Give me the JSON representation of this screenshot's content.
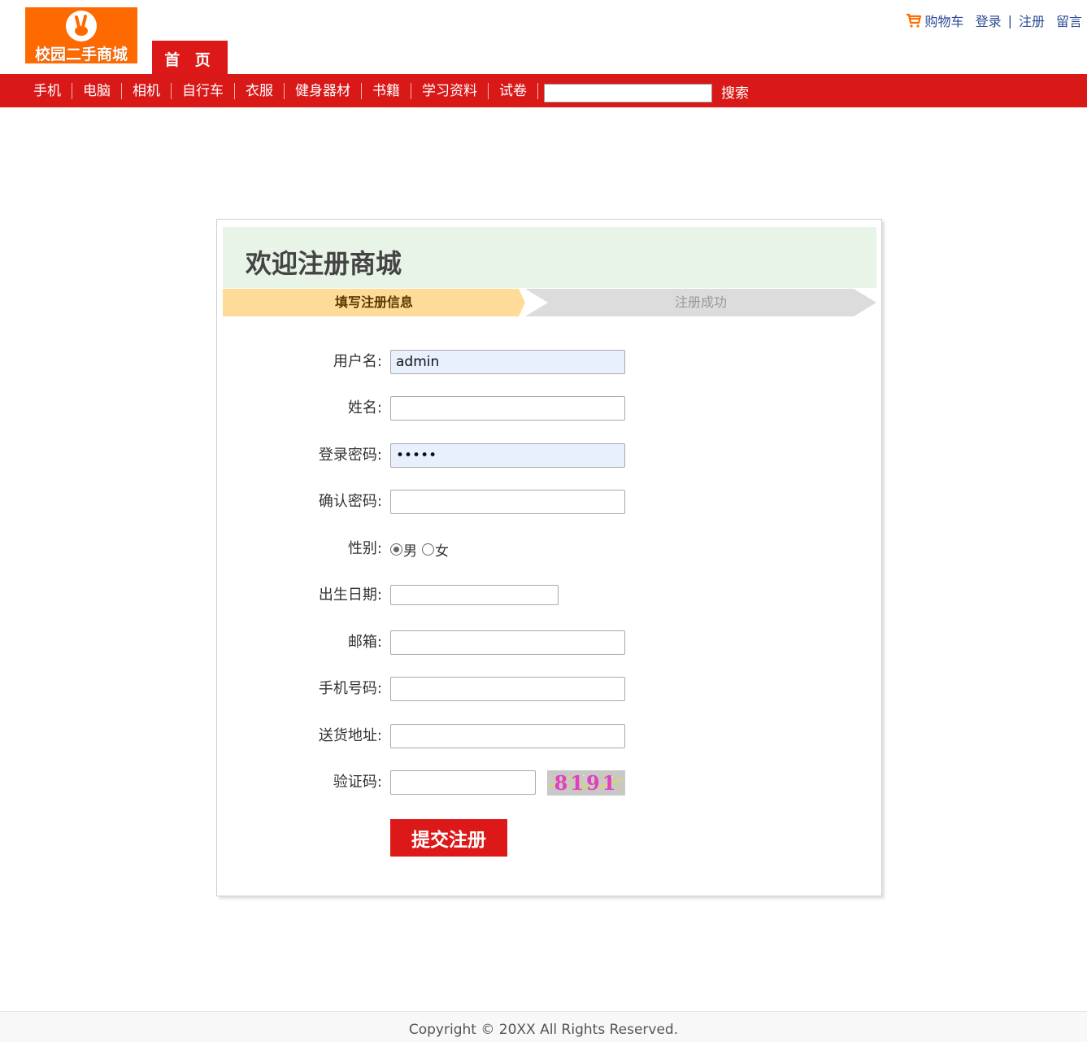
{
  "header": {
    "logo_text": "校园二手商城",
    "logo_icon": "victory-hand-icon",
    "home_tab": "首 页",
    "top_links": {
      "cart": "购物车",
      "login": "登录",
      "separator": "|",
      "register": "注册",
      "message": "留言"
    }
  },
  "nav": {
    "items": [
      "手机",
      "电脑",
      "相机",
      "自行车",
      "衣服",
      "健身器材",
      "书籍",
      "学习资料",
      "试卷"
    ],
    "search_value": "",
    "search_button": "搜索"
  },
  "panel": {
    "title": "欢迎注册商城",
    "steps": [
      "填写注册信息",
      "注册成功"
    ]
  },
  "form": {
    "username": {
      "label": "用户名:",
      "value": "admin"
    },
    "realname": {
      "label": "姓名:",
      "value": ""
    },
    "password": {
      "label": "登录密码:",
      "value": "•••••"
    },
    "confirm_password": {
      "label": "确认密码:",
      "value": ""
    },
    "gender": {
      "label": "性别:",
      "options": [
        "男",
        "女"
      ],
      "selected": "男"
    },
    "birthday": {
      "label": "出生日期:",
      "value": ""
    },
    "email": {
      "label": "邮箱:",
      "value": ""
    },
    "phone": {
      "label": "手机号码:",
      "value": ""
    },
    "address": {
      "label": "送货地址:",
      "value": ""
    },
    "captcha": {
      "label": "验证码:",
      "value": "",
      "image_text": "8191"
    },
    "submit": "提交注册"
  },
  "footer": {
    "copyright": "Copyright © 20XX All Rights Reserved."
  },
  "colors": {
    "brand_red": "#dc1818",
    "logo_orange": "#ff6a00",
    "link_blue": "#2b4a95",
    "step_active": "#ffdb99",
    "step_inactive": "#dcdcdc"
  }
}
